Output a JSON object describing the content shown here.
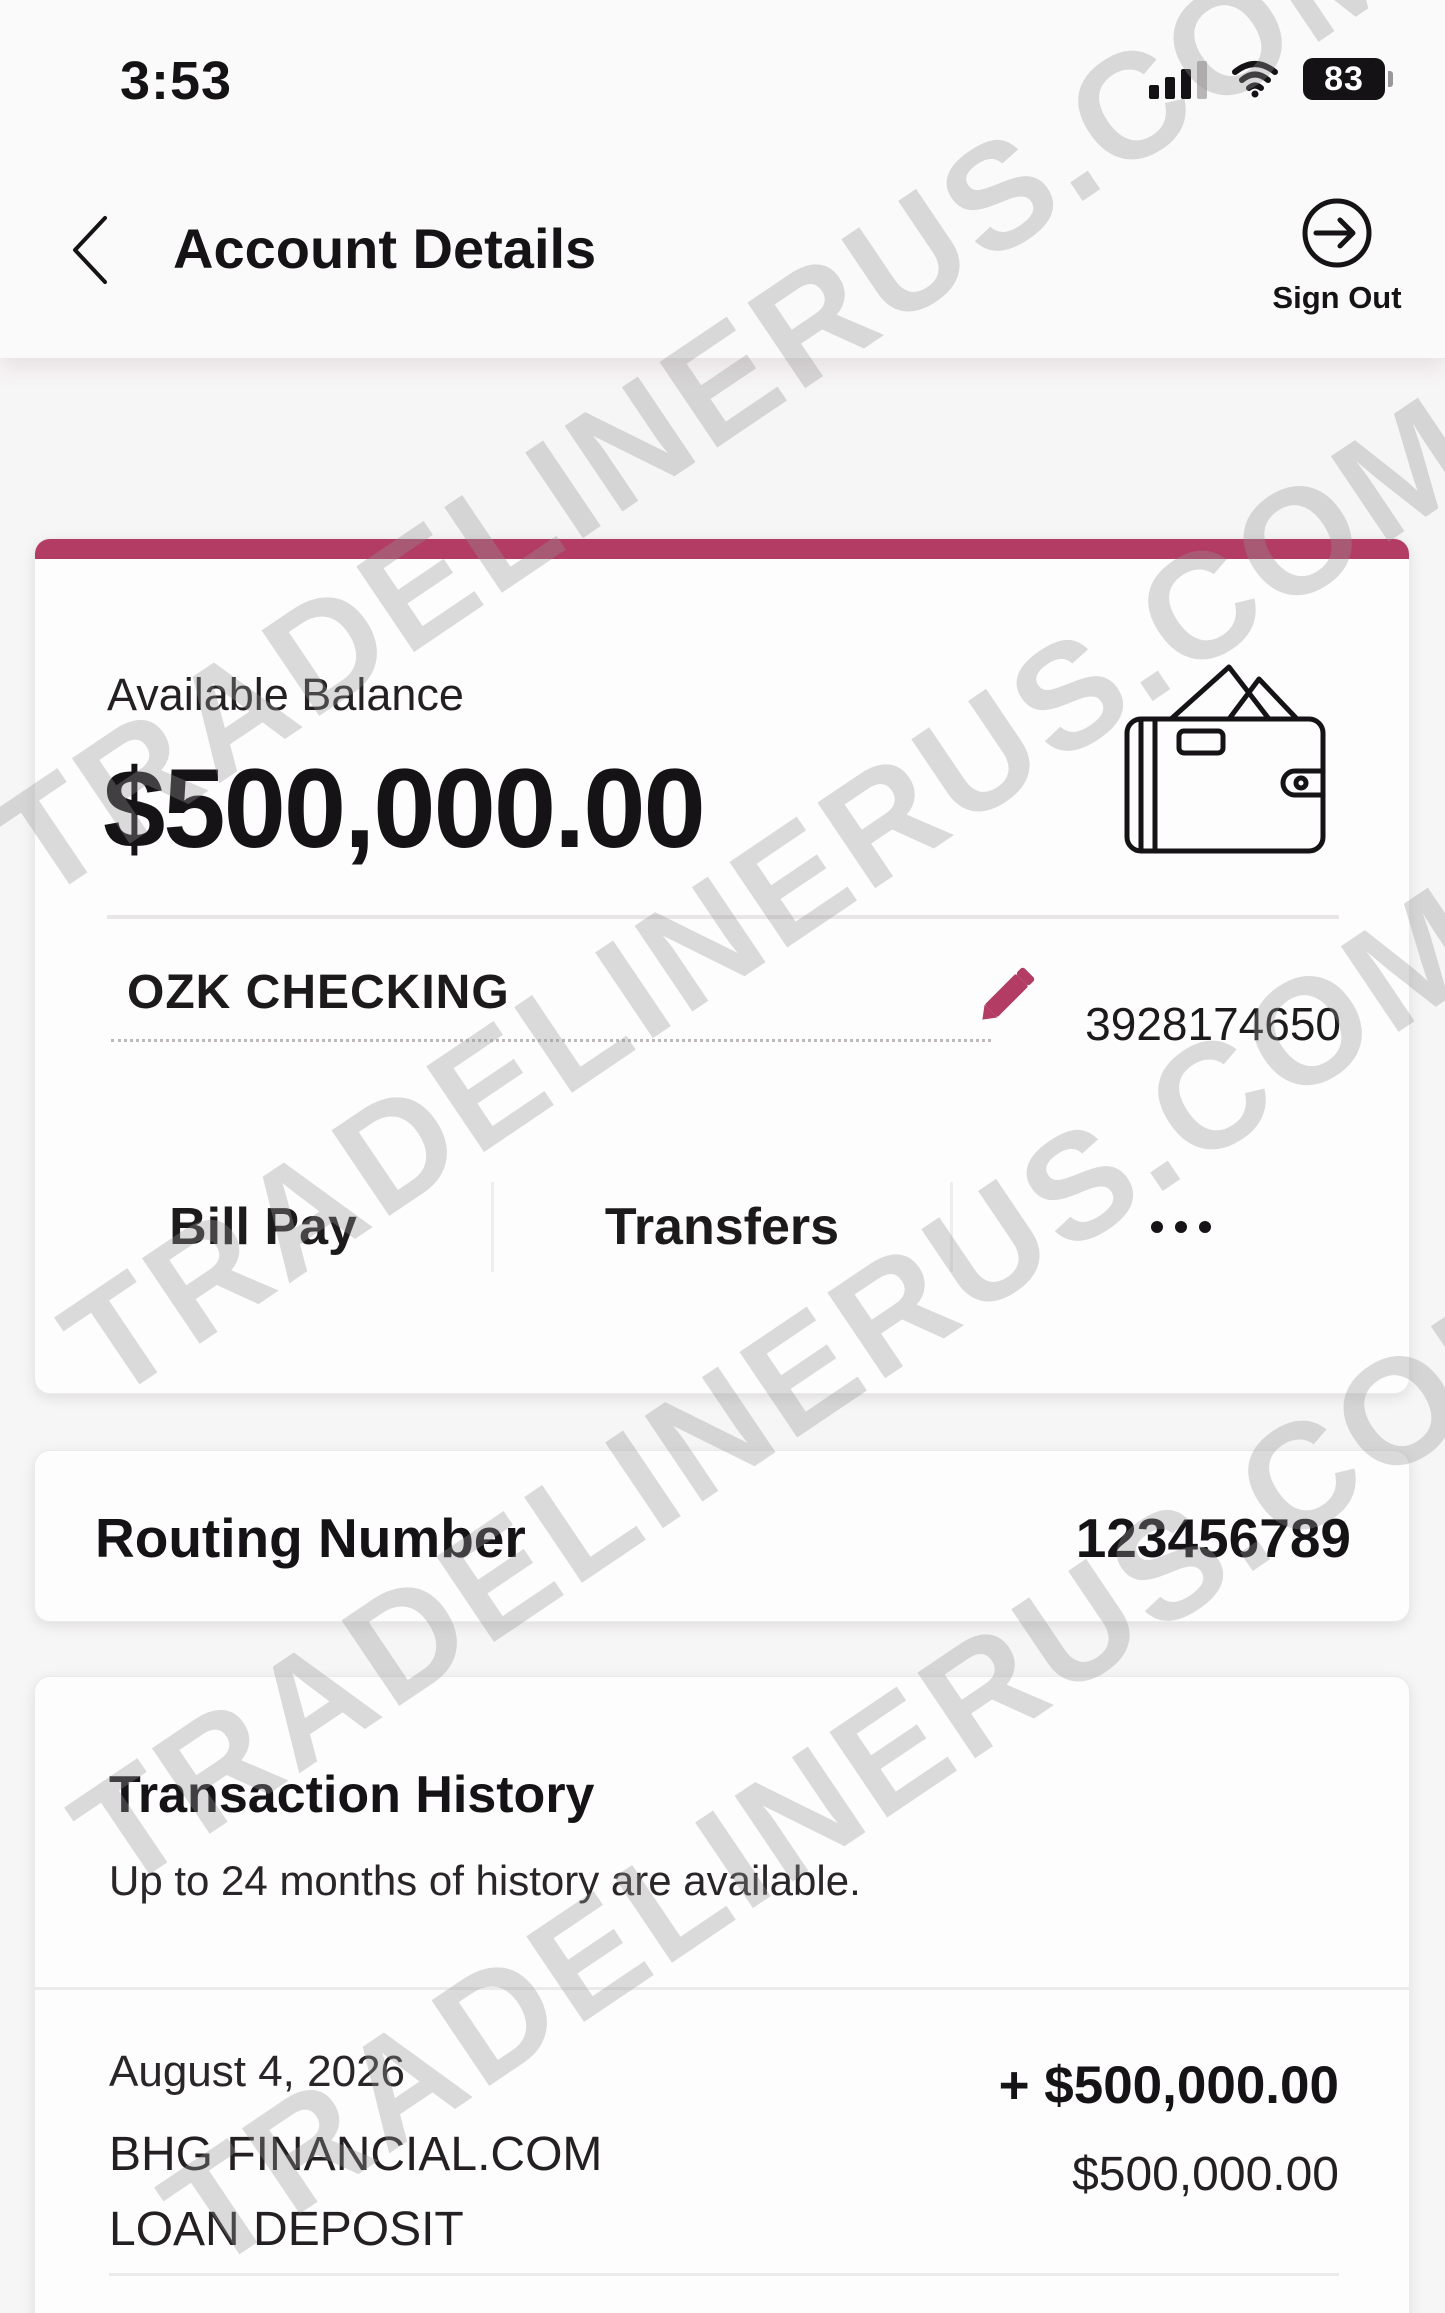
{
  "status_bar": {
    "time": "3:53",
    "battery": "83",
    "icons": [
      "signal-icon",
      "wifi-icon",
      "battery-icon"
    ]
  },
  "header": {
    "back_icon": "chevron-left-icon",
    "title": "Account Details",
    "sign_out_label": "Sign Out",
    "sign_out_icon": "sign-out-icon"
  },
  "colors": {
    "accent": "#b23c64",
    "background": "#f7f6f6",
    "text": "#161316"
  },
  "balance_card": {
    "label": "Available Balance",
    "amount": "$500,000.00",
    "icon": "wallet-icon",
    "account_name": "OZK CHECKING",
    "edit_icon": "pencil-icon",
    "account_number": "3928174650",
    "actions": {
      "bill_pay": "Bill Pay",
      "transfers": "Transfers",
      "more_icon": "more-dots-icon"
    }
  },
  "routing": {
    "label": "Routing Number",
    "value": "123456789"
  },
  "history": {
    "title": "Transaction History",
    "subtitle": "Up to 24 months of history are available.",
    "transactions": [
      {
        "date": "August 4, 2026",
        "description_line1": "BHG FINANCIAL.COM",
        "description_line2": "LOAN DEPOSIT",
        "amount": "+ $500,000.00",
        "balance": "$500,000.00"
      }
    ]
  },
  "watermark": {
    "text": "TRADELINERUS.COM"
  }
}
